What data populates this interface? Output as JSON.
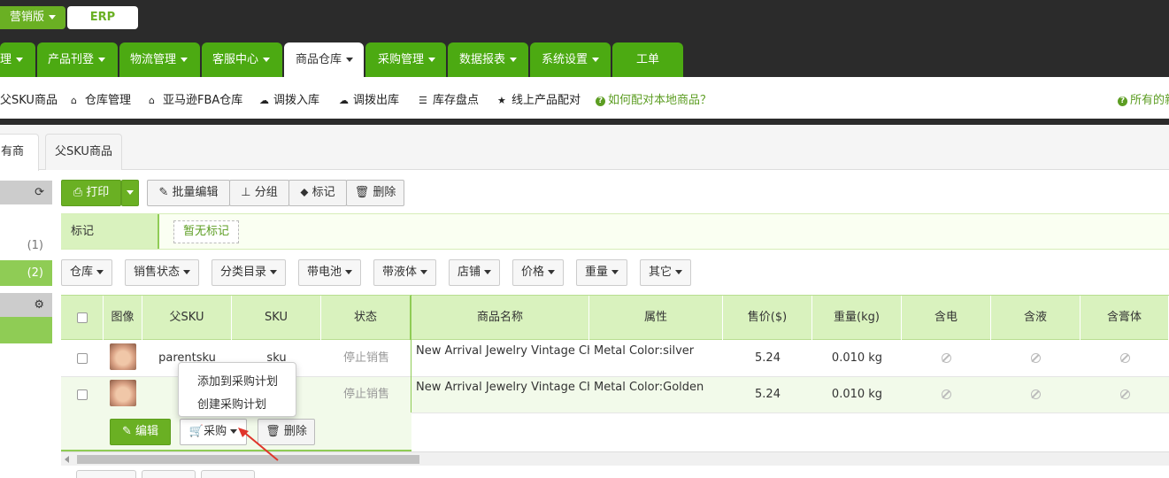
{
  "header": {
    "edition_label": "营销版",
    "erp_label": "ERP"
  },
  "main_nav": [
    {
      "label": "理",
      "caret": true,
      "active": false
    },
    {
      "label": "产品刊登",
      "caret": true,
      "active": false
    },
    {
      "label": "物流管理",
      "caret": true,
      "active": false
    },
    {
      "label": "客服中心",
      "caret": true,
      "active": false
    },
    {
      "label": "商品仓库",
      "caret": true,
      "active": true
    },
    {
      "label": "采购管理",
      "caret": true,
      "active": false
    },
    {
      "label": "数据报表",
      "caret": true,
      "active": false
    },
    {
      "label": "系统设置",
      "caret": true,
      "active": false
    },
    {
      "label": "工单",
      "caret": false,
      "active": false
    }
  ],
  "sub_nav": {
    "items": [
      {
        "label": "父SKU商品",
        "icon": ""
      },
      {
        "label": "仓库管理",
        "icon": "home-icon"
      },
      {
        "label": "亚马逊FBA仓库",
        "icon": "home-icon"
      },
      {
        "label": "调拨入库",
        "icon": "cloud-upload-icon"
      },
      {
        "label": "调拨出库",
        "icon": "cloud-download-icon"
      },
      {
        "label": "库存盘点",
        "icon": "inbox-icon"
      },
      {
        "label": "线上产品配对",
        "icon": "star-icon"
      }
    ],
    "help_link": "如何配对本地商品？",
    "help_link_right": "所有的新"
  },
  "content_tabs": {
    "all": "有商品",
    "parent_sku": "父SKU商品"
  },
  "sidebar": {
    "count_1": "(1)",
    "count_2": "(2)"
  },
  "toolbar": {
    "print": "打印",
    "batch_edit": "批量编辑",
    "group": "分组",
    "mark": "标记",
    "delete": "删除"
  },
  "mark_bar": {
    "label": "标记",
    "empty": "暂无标记"
  },
  "filters": [
    "仓库",
    "销售状态",
    "分类目录",
    "带电池",
    "带液体",
    "店铺",
    "价格",
    "重量",
    "其它"
  ],
  "table": {
    "headers": {
      "image": "图像",
      "parent_sku": "父SKU",
      "sku": "SKU",
      "status": "状态",
      "name": "商品名称",
      "attr": "属性",
      "price": "售价($)",
      "weight": "重量(kg)",
      "battery": "含电",
      "liquid": "含液",
      "paste": "含膏体"
    },
    "rows": [
      {
        "parent_sku": "parentsku",
        "sku": "sku",
        "status": "停止销售",
        "name": "New Arrival Jewelry Vintage Ch",
        "attr": "Metal Color:silver",
        "price": "5.24",
        "weight": "0.010 kg"
      },
      {
        "parent_sku": "",
        "sku": "",
        "status": "停止销售",
        "name": "New Arrival Jewelry Vintage Ch",
        "attr": "Metal Color:Golden",
        "price": "5.24",
        "weight": "0.010 kg"
      }
    ],
    "actions": {
      "edit": "编辑",
      "purchase": "采购",
      "delete": "删除"
    }
  },
  "purchase_dropdown": {
    "add_to_plan": "添加到采购计划",
    "create_plan": "创建采购计划"
  },
  "colors": {
    "brand_green": "#6ab023",
    "header_bg": "#2b2b2b",
    "table_header_bg": "#d9f2be",
    "annotation_arrow": "#e0352b"
  }
}
